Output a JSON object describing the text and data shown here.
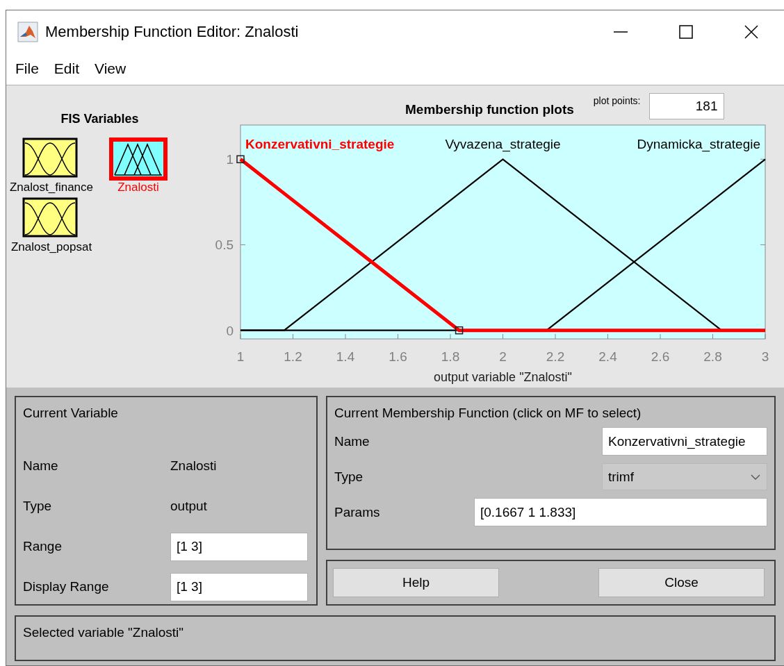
{
  "window": {
    "title": "Membership Function Editor: Znalosti"
  },
  "menu": [
    "File",
    "Edit",
    "View"
  ],
  "fis_variables": {
    "title": "FIS Variables",
    "items": [
      {
        "name": "Znalost_finance",
        "kind": "input",
        "selected": false
      },
      {
        "name": "Znalosti",
        "kind": "output",
        "selected": true
      },
      {
        "name": "Znalost_popsat",
        "kind": "input",
        "selected": false
      }
    ]
  },
  "plot": {
    "plot_points_label": "plot points:",
    "plot_points": "181",
    "chart_data": {
      "type": "line",
      "title": "Membership function plots",
      "xlabel": "output variable \"Znalosti\"",
      "x": [
        1,
        1.1667,
        1.8333,
        2,
        2.1667,
        2.8333,
        3
      ],
      "series": [
        {
          "name": "Konzervativni_strategie",
          "color": "#ff0000",
          "values": [
            1,
            0.8,
            0,
            0,
            0,
            0,
            0
          ]
        },
        {
          "name": "Vyvazena_strategie",
          "color": "#000000",
          "values": [
            0,
            0,
            0.8,
            1,
            0.8,
            0,
            0
          ]
        },
        {
          "name": "Dynamicka_strategie",
          "color": "#000000",
          "values": [
            0,
            0,
            0,
            0,
            0,
            0.8,
            1
          ]
        }
      ],
      "xlim": [
        1,
        3
      ],
      "ylim": [
        -0.05,
        1.2
      ],
      "xticks": [
        1,
        1.2,
        1.4,
        1.6,
        1.8,
        2,
        2.2,
        2.4,
        2.6,
        2.8,
        3
      ],
      "yticks": [
        0,
        0.5,
        1
      ]
    },
    "membership_functions": [
      {
        "selected": true
      },
      {
        "selected": false
      },
      {
        "selected": false
      }
    ]
  },
  "current_variable": {
    "title": "Current Variable",
    "name_label": "Name",
    "name": "Znalosti",
    "type_label": "Type",
    "type": "output",
    "range_label": "Range",
    "range": "[1 3]",
    "display_range_label": "Display Range",
    "display_range": "[1 3]"
  },
  "current_mf": {
    "title": "Current Membership Function (click on MF to select)",
    "name_label": "Name",
    "name": "Konzervativni_strategie",
    "type_label": "Type",
    "type": "trimf",
    "params_label": "Params",
    "params": "[0.1667 1 1.833]"
  },
  "buttons": [
    "Help",
    "Close"
  ],
  "status": "Selected variable \"Znalosti\""
}
